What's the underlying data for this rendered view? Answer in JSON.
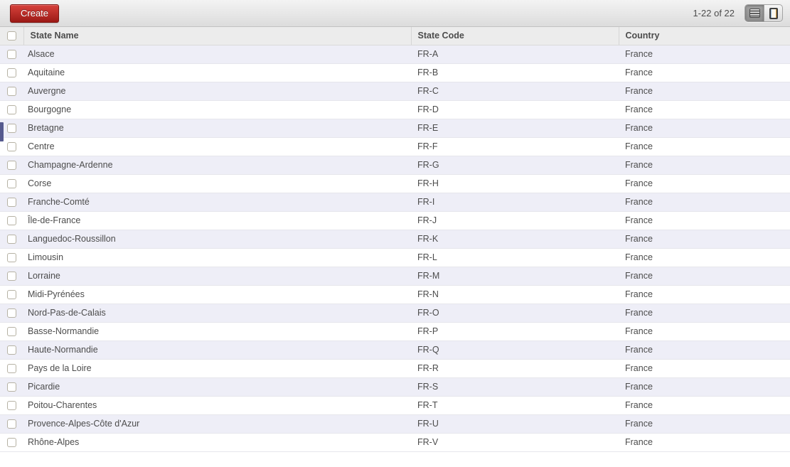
{
  "toolbar": {
    "create_label": "Create",
    "pager_text": "1-22 of 22",
    "view_switcher": {
      "list_active": true,
      "form_active": false
    }
  },
  "table": {
    "columns": [
      "State Name",
      "State Code",
      "Country"
    ],
    "rows": [
      {
        "name": "Alsace",
        "code": "FR-A",
        "country": "France"
      },
      {
        "name": "Aquitaine",
        "code": "FR-B",
        "country": "France"
      },
      {
        "name": "Auvergne",
        "code": "FR-C",
        "country": "France"
      },
      {
        "name": "Bourgogne",
        "code": "FR-D",
        "country": "France"
      },
      {
        "name": "Bretagne",
        "code": "FR-E",
        "country": "France"
      },
      {
        "name": "Centre",
        "code": "FR-F",
        "country": "France"
      },
      {
        "name": "Champagne-Ardenne",
        "code": "FR-G",
        "country": "France"
      },
      {
        "name": "Corse",
        "code": "FR-H",
        "country": "France"
      },
      {
        "name": "Franche-Comté",
        "code": "FR-I",
        "country": "France"
      },
      {
        "name": "Île-de-France",
        "code": "FR-J",
        "country": "France"
      },
      {
        "name": "Languedoc-Roussillon",
        "code": "FR-K",
        "country": "France"
      },
      {
        "name": "Limousin",
        "code": "FR-L",
        "country": "France"
      },
      {
        "name": "Lorraine",
        "code": "FR-M",
        "country": "France"
      },
      {
        "name": "Midi-Pyrénées",
        "code": "FR-N",
        "country": "France"
      },
      {
        "name": "Nord-Pas-de-Calais",
        "code": "FR-O",
        "country": "France"
      },
      {
        "name": "Basse-Normandie",
        "code": "FR-P",
        "country": "France"
      },
      {
        "name": "Haute-Normandie",
        "code": "FR-Q",
        "country": "France"
      },
      {
        "name": "Pays de la Loire",
        "code": "FR-R",
        "country": "France"
      },
      {
        "name": "Picardie",
        "code": "FR-S",
        "country": "France"
      },
      {
        "name": "Poitou-Charentes",
        "code": "FR-T",
        "country": "France"
      },
      {
        "name": "Provence-Alpes-Côte d'Azur",
        "code": "FR-U",
        "country": "France"
      },
      {
        "name": "Rhône-Alpes",
        "code": "FR-V",
        "country": "France"
      }
    ]
  },
  "icons": {
    "list_view": "list-view-icon",
    "form_view": "form-view-icon"
  },
  "colors": {
    "create_button_top": "#d7423c",
    "create_button_bottom": "#9c1a16",
    "row_stripe": "#eeeef7",
    "edge_marker": "#565a8e",
    "text": "#4c4c4c",
    "toolbar_top": "#f3f3f3",
    "toolbar_bottom": "#dcdcdc",
    "header_bg": "#ececec"
  }
}
